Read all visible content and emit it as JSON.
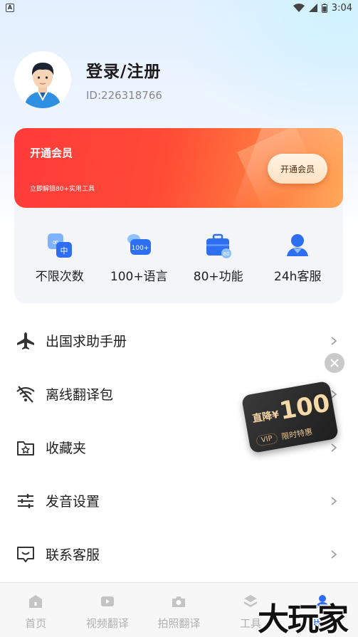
{
  "status_bar": {
    "app_badge": "A",
    "time": "3:04"
  },
  "profile": {
    "title": "登录/注册",
    "user_id": "ID:226318766"
  },
  "vip": {
    "title": "开通会员",
    "subtitle": "立即解锁80+实用工具",
    "button_label": "开通会员",
    "features": [
      {
        "icon": "infinity-translate-icon",
        "label": "不限次数"
      },
      {
        "icon": "chat-bubbles-icon",
        "label": "100+语言"
      },
      {
        "icon": "toolbox-icon",
        "label": "80+功能"
      },
      {
        "icon": "support-agent-icon",
        "label": "24h客服"
      }
    ],
    "brand_color": "#ff3b3b"
  },
  "menu": {
    "items": [
      {
        "icon": "airplane-icon",
        "label": "出国求助手册"
      },
      {
        "icon": "wifi-off-icon",
        "label": "离线翻译包"
      },
      {
        "icon": "folder-star-icon",
        "label": "收藏夹"
      },
      {
        "icon": "sliders-icon",
        "label": "发音设置"
      },
      {
        "icon": "message-box-icon",
        "label": "联系客服"
      }
    ]
  },
  "promo": {
    "prefix": "直降¥",
    "amount": "100",
    "vip": "VIP",
    "tag": "限时特惠"
  },
  "bottom_nav": {
    "items": [
      {
        "icon": "home-icon",
        "label": "首页",
        "active": false
      },
      {
        "icon": "video-icon",
        "label": "视频翻译",
        "active": false
      },
      {
        "icon": "camera-icon",
        "label": "拍照翻译",
        "active": false
      },
      {
        "icon": "tools-icon",
        "label": "工具",
        "active": false
      },
      {
        "icon": "user-icon",
        "label": "我的",
        "active": true
      }
    ],
    "active_color": "#2c6bff"
  },
  "watermark": "大玩家"
}
